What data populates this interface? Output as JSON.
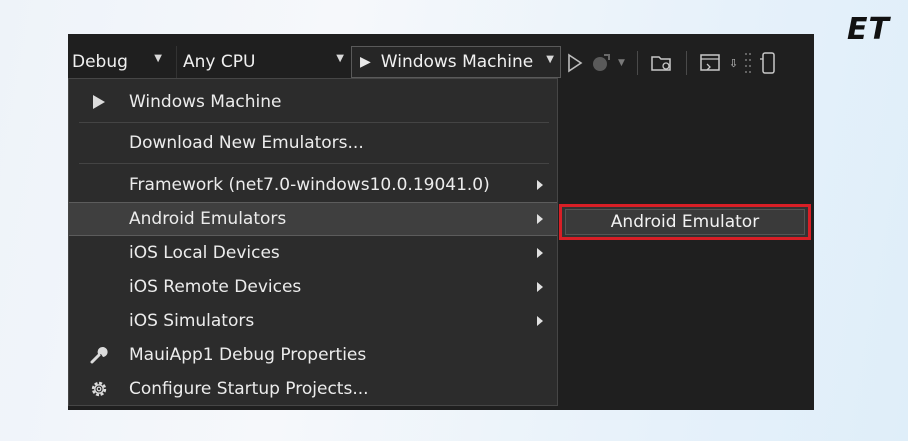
{
  "brand": {
    "logo_text": "ET"
  },
  "toolbar": {
    "config_label": "Debug",
    "platform_label": "Any CPU",
    "run_target_label": "Windows Machine"
  },
  "menu": {
    "items": [
      {
        "label": "Windows Machine",
        "icon": "play-icon",
        "submenu": false
      },
      {
        "label": "Download New Emulators...",
        "icon": "",
        "submenu": false
      },
      {
        "label": "Framework (net7.0-windows10.0.19041.0)",
        "icon": "",
        "submenu": true
      },
      {
        "label": "Android Emulators",
        "icon": "",
        "submenu": true,
        "highlighted": true
      },
      {
        "label": "iOS Local Devices",
        "icon": "",
        "submenu": true
      },
      {
        "label": "iOS Remote Devices",
        "icon": "",
        "submenu": true
      },
      {
        "label": "iOS Simulators",
        "icon": "",
        "submenu": true
      },
      {
        "label": "MauiApp1 Debug Properties",
        "icon": "wrench-icon",
        "submenu": false
      },
      {
        "label": "Configure Startup Projects...",
        "icon": "gear-icon",
        "submenu": false
      }
    ]
  },
  "submenu": {
    "items": [
      {
        "label": "Android Emulator",
        "highlight_color": "#d81f26"
      }
    ]
  }
}
